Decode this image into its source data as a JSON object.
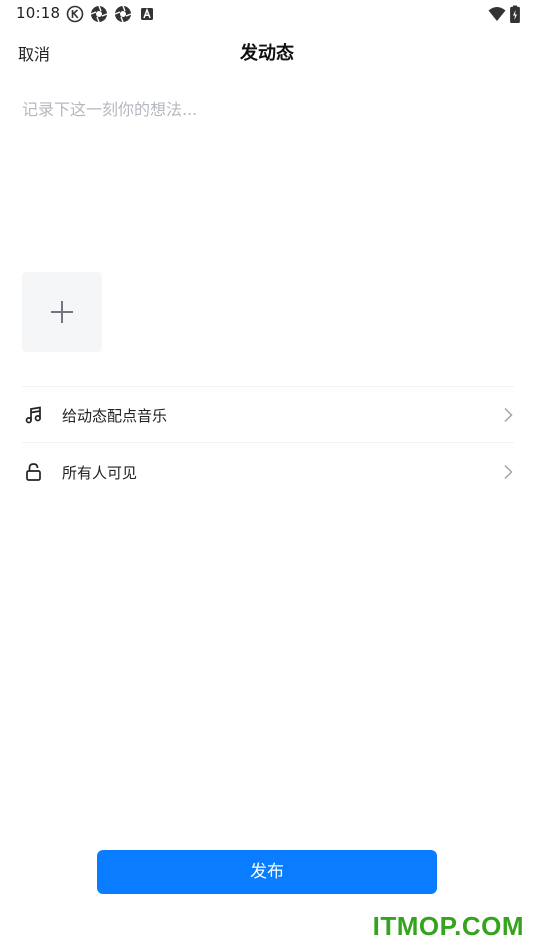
{
  "status_bar": {
    "time": "10:18",
    "icons": [
      "k-circle-icon",
      "aperture-icon",
      "aperture-icon",
      "a-box-icon"
    ],
    "right_icons": [
      "wifi-icon",
      "battery-charging-icon"
    ]
  },
  "header": {
    "cancel_label": "取消",
    "title": "发动态"
  },
  "composer": {
    "placeholder": "记录下这一刻你的想法...",
    "value": ""
  },
  "add_image": {
    "icon": "plus-icon"
  },
  "options": [
    {
      "icon": "music-note-icon",
      "label": "给动态配点音乐"
    },
    {
      "icon": "unlock-icon",
      "label": "所有人可见"
    }
  ],
  "publish_label": "发布",
  "watermark": "ITMOP.COM",
  "colors": {
    "accent": "#0a7cff",
    "placeholder": "#b4b8bf",
    "tile_bg": "#f5f6f8",
    "watermark": "#36a31e"
  }
}
